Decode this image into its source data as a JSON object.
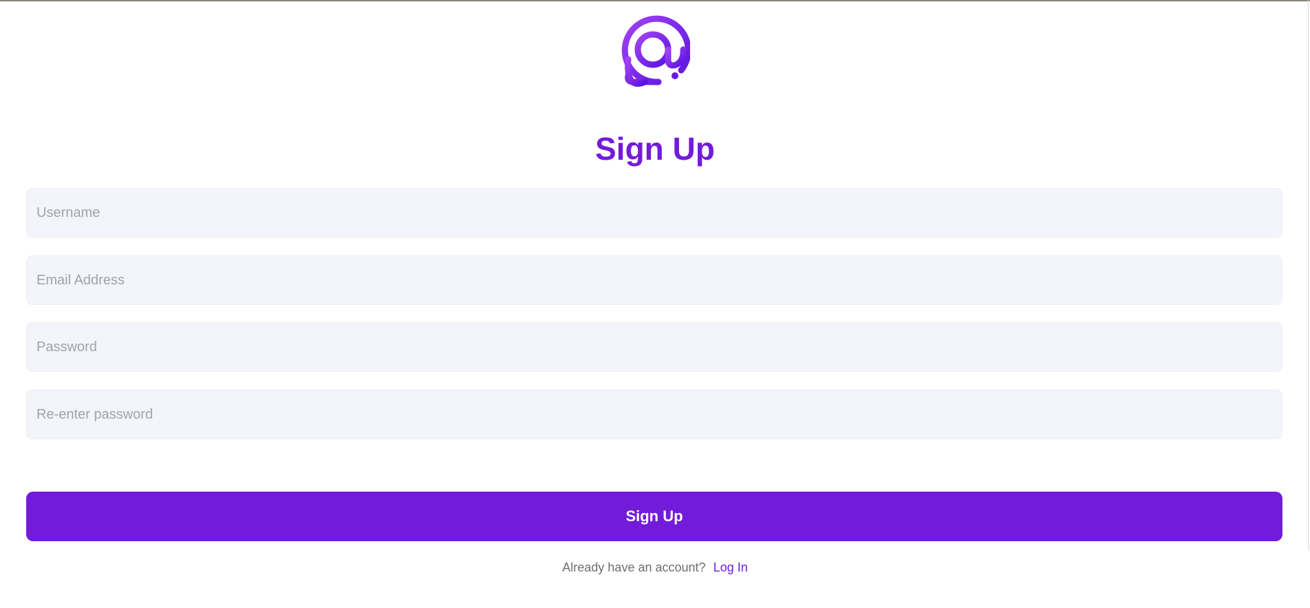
{
  "brand": {
    "logo_icon": "at-sign-chat-bubble-icon",
    "accent_color": "#721bda",
    "gradient_from": "#9b3cf0",
    "gradient_to": "#5a14e0"
  },
  "page": {
    "title": "Sign Up"
  },
  "form": {
    "username_placeholder": "Username",
    "email_placeholder": "Email Address",
    "password_placeholder": "Password",
    "confirm_password_placeholder": "Re-enter password",
    "submit_label": "Sign Up"
  },
  "footer": {
    "prompt_text": "Already have an account?",
    "login_link": "Log In"
  }
}
